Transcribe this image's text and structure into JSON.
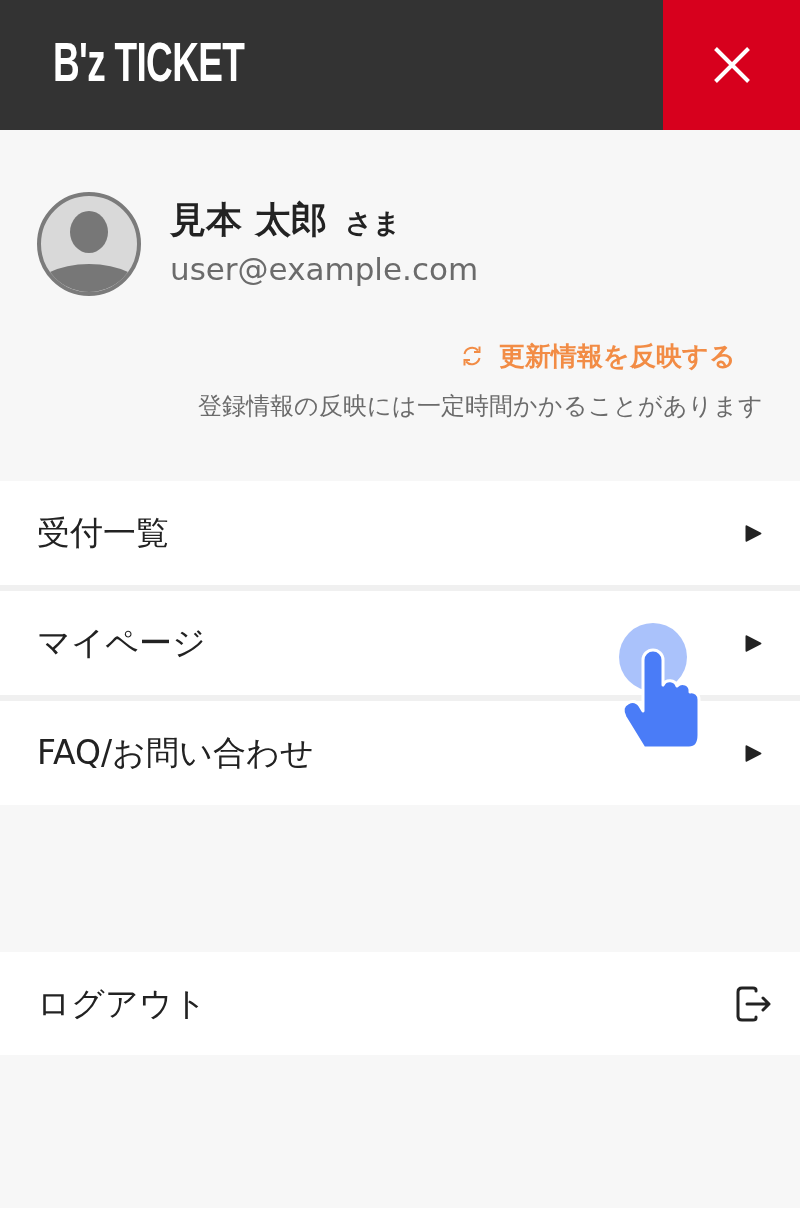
{
  "header": {
    "logo": "B'z TICKET"
  },
  "profile": {
    "name": "見本 太郎",
    "honorific": "さま",
    "email": "user@example.com",
    "refresh_link": "更新情報を反映する",
    "note": "登録情報の反映には一定時間かかることがあります"
  },
  "menu": [
    {
      "label": "受付一覧"
    },
    {
      "label": "マイページ"
    },
    {
      "label": "FAQ/お問い合わせ"
    }
  ],
  "logout": {
    "label": "ログアウト"
  }
}
